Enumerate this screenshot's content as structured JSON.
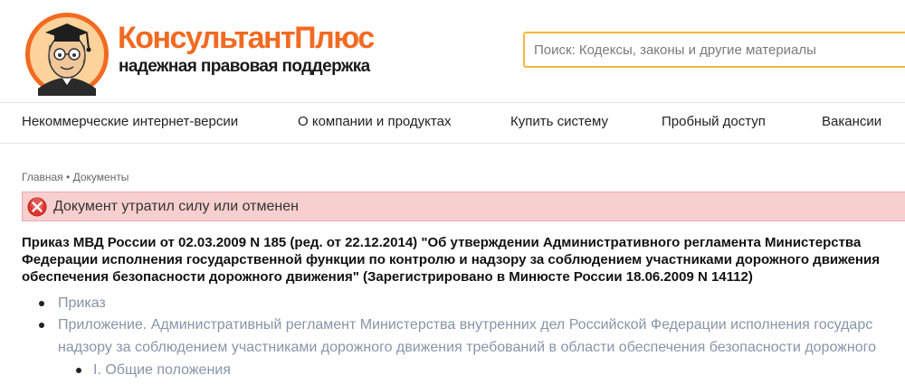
{
  "header": {
    "brand_name": "КонсультантПлюс",
    "tagline": "надежная правовая поддержка",
    "search_placeholder": "Поиск: Кодексы, законы и другие материалы"
  },
  "nav": {
    "items": [
      "Некоммерческие интернет-версии",
      "О компании и продуктах",
      "Купить систему",
      "Пробный доступ",
      "Вакансии"
    ]
  },
  "breadcrumb": {
    "home": "Главная",
    "separator": "•",
    "current": "Документы"
  },
  "alert": {
    "text": "Документ утратил силу или отменен",
    "color": "#f8cfcf"
  },
  "document": {
    "title_lines": [
      "Приказ МВД России от 02.03.2009 N 185 (ред. от 22.12.2014) \"Об утверждении Административного регламента Министерства",
      "Федерации исполнения государственной функции по контролю и надзору за соблюдением участниками дорожного движения",
      "обеспечения безопасности дорожного движения\" (Зарегистрировано в Минюсте России 18.06.2009 N 14112)"
    ]
  },
  "toc": {
    "items": [
      "Приказ",
      "Приложение. Административный регламент Министерства внутренних дел Российской Федерации исполнения государс",
      "надзору за соблюдением участниками дорожного движения требований в области обеспечения безопасности дорожного",
      "I. Общие положения"
    ]
  },
  "colors": {
    "brand_orange": "#f26a21",
    "link_gray": "#8795a8",
    "search_border": "#f5b93a"
  }
}
